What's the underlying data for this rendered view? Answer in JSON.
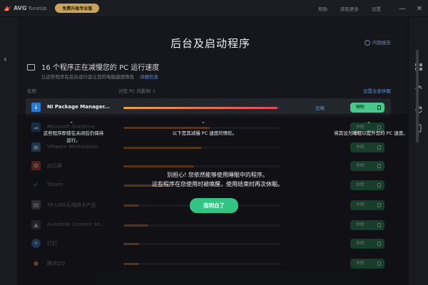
{
  "titlebar": {
    "app_name": "AVG",
    "app_sub": "TuneUp",
    "upgrade_label": "免费升级专业版",
    "link_1": "帮助",
    "link_2": "获取更多",
    "link_3": "设置",
    "minimize_glyph": "—",
    "close_glyph": "✕"
  },
  "page": {
    "title": "后台及启动程序",
    "help_label": "问题报告",
    "back_glyph": "‹"
  },
  "summary": {
    "title": "16 个程序正在减慢您的 PC 运行速度",
    "subtitle": "让这些程序在后台运行会让您的电脑速度降低",
    "link": "详细信息"
  },
  "columns": {
    "name": "名称",
    "impact": "对您 PC 的影响 ⇩",
    "right": "设置全部休眠"
  },
  "rows": [
    {
      "name": "NI Package Manager...",
      "impact": 0.98,
      "ignore": "忽略",
      "toggle": "睡眠"
    },
    {
      "name": "Microsoft OneDrive",
      "impact": 0.55,
      "ignore": "",
      "toggle": "休眠"
    },
    {
      "name": "VMware Workstation",
      "impact": 0.5,
      "ignore": "",
      "toggle": "休眠"
    },
    {
      "name": "向日葵",
      "impact": 0.45,
      "ignore": "",
      "toggle": "休眠"
    },
    {
      "name": "Steam",
      "impact": 0.3,
      "ignore": "",
      "toggle": "休眠"
    },
    {
      "name": "TP-LINK无线网卡产品",
      "impact": 0.1,
      "ignore": "",
      "toggle": "休眠"
    },
    {
      "name": "Autodesk Content Se...",
      "impact": 0.16,
      "ignore": "",
      "toggle": "休眠"
    },
    {
      "name": "钉钉",
      "impact": 0.1,
      "ignore": "",
      "toggle": "休眠"
    },
    {
      "name": "腾讯QQ",
      "impact": 0.1,
      "ignore": "",
      "toggle": "休眠"
    }
  ],
  "tips": {
    "left": "这些程序即使在关闭后仍保持\n运行。",
    "middle": "以下是其减慢 PC 速度的情形。",
    "right": "将其设为睡眠以提升您的 PC 速度。",
    "center_line1": "别担心! 您依然能够使用睡眠中的程序。",
    "center_line2": "这些程序在您使用时被唤醒，使用结束时再次休眠。",
    "got_it": "我明白了"
  },
  "colors": {
    "accent_green": "#33c484",
    "bar_gradient_start": "#f2a23a",
    "bar_gradient_end": "#e8455a",
    "bar_orange": "#c6722a"
  }
}
